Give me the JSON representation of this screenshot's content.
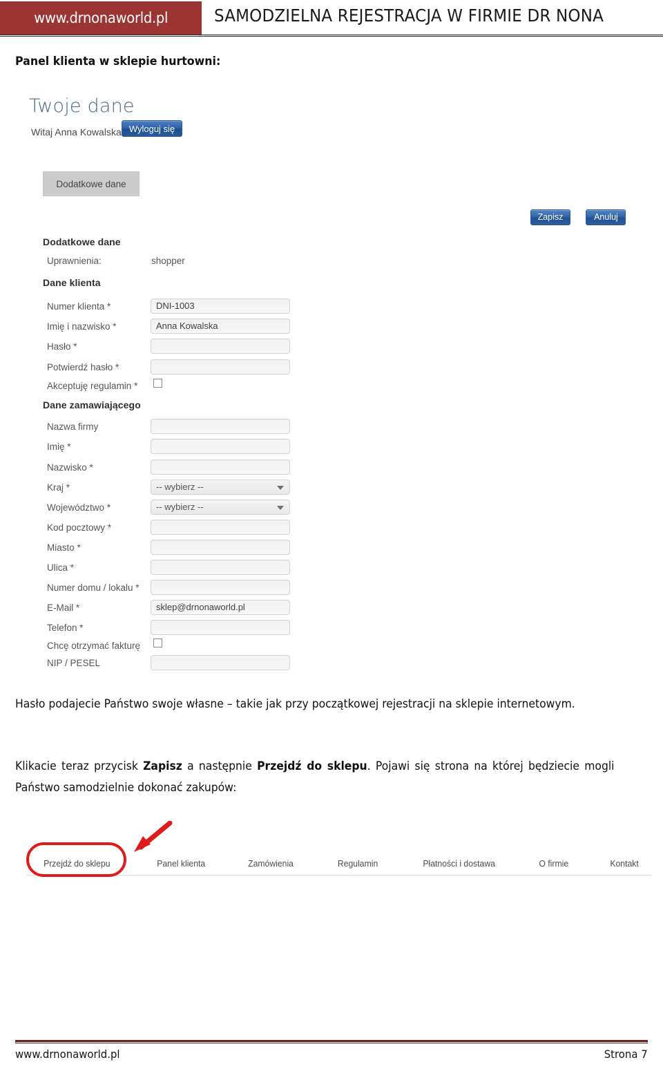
{
  "header": {
    "logo_text": "www.drnonaworld.pl",
    "title": "SAMODZIELNA REJESTRACJA W FIRMIE DR NONA",
    "brand_color": "#9d3434"
  },
  "page_title": "Panel klienta w sklepie hurtowni:",
  "screenshot": {
    "heading": "Twoje dane",
    "greeting": "Witaj Anna Kowalska",
    "logout_button": "Wyloguj się",
    "tab_label": "Dodatkowe dane",
    "save_button": "Zapisz",
    "cancel_button": "Anuluj",
    "section_extra": {
      "title": "Dodatkowe dane",
      "permission_label": "Uprawnienia:",
      "permission_value": "shopper"
    },
    "section_client": {
      "title": "Dane klienta",
      "fields": [
        {
          "label": "Numer klienta *",
          "value": "DNI-1003",
          "type": "text"
        },
        {
          "label": "Imię i nazwisko *",
          "value": "Anna Kowalska",
          "type": "text"
        },
        {
          "label": "Hasło *",
          "value": "",
          "type": "password"
        },
        {
          "label": "Potwierdź hasło *",
          "value": "",
          "type": "password"
        },
        {
          "label": "Akceptuję regulamin *",
          "value": "",
          "type": "checkbox",
          "checked": false
        }
      ]
    },
    "section_order": {
      "title": "Dane zamawiającego",
      "fields": [
        {
          "label": "Nazwa firmy",
          "value": "",
          "type": "text"
        },
        {
          "label": "Imię *",
          "value": "",
          "type": "text"
        },
        {
          "label": "Nazwisko *",
          "value": "",
          "type": "text"
        },
        {
          "label": "Kraj *",
          "value": "-- wybierz --",
          "type": "select"
        },
        {
          "label": "Województwo *",
          "value": "-- wybierz --",
          "type": "select"
        },
        {
          "label": "Kod pocztowy *",
          "value": "",
          "type": "text"
        },
        {
          "label": "Miasto *",
          "value": "",
          "type": "text"
        },
        {
          "label": "Ulica *",
          "value": "",
          "type": "text"
        },
        {
          "label": "Numer domu / lokalu *",
          "value": "",
          "type": "text"
        },
        {
          "label": "E-Mail *",
          "value": "sklep@drnonaworld.pl",
          "type": "text"
        },
        {
          "label": "Telefon *",
          "value": "",
          "type": "text"
        },
        {
          "label": "Chcę otrzymać fakturę",
          "value": "",
          "type": "checkbox",
          "checked": false
        },
        {
          "label": "NIP / PESEL",
          "value": "",
          "type": "text"
        }
      ]
    }
  },
  "body": {
    "paragraph1": "Hasło podajecie Państwo swoje własne – takie jak przy początkowej rejestracji na sklepie internetowym.",
    "paragraph2_pre": "Klikacie teraz przycisk ",
    "paragraph2_b1": "Zapisz",
    "paragraph2_mid": " a następnie ",
    "paragraph2_b2": "Przejdź do sklepu",
    "paragraph2_post": ". Pojawi się strona na której będziecie mogli Państwo samodzielnie dokonać zakupów:"
  },
  "menu": {
    "items": [
      "Przejdź do sklepu",
      "Panel klienta",
      "Zamówienia",
      "Regulamin",
      "Płatności i dostawa",
      "O firmie",
      "Kontakt"
    ],
    "highlight_color": "#e01b1b",
    "highlighted_item": "Przejdź do sklepu"
  },
  "footer": {
    "left": "www.drnonaworld.pl",
    "right": "Strona 7",
    "rule_color": "#6b2020"
  }
}
